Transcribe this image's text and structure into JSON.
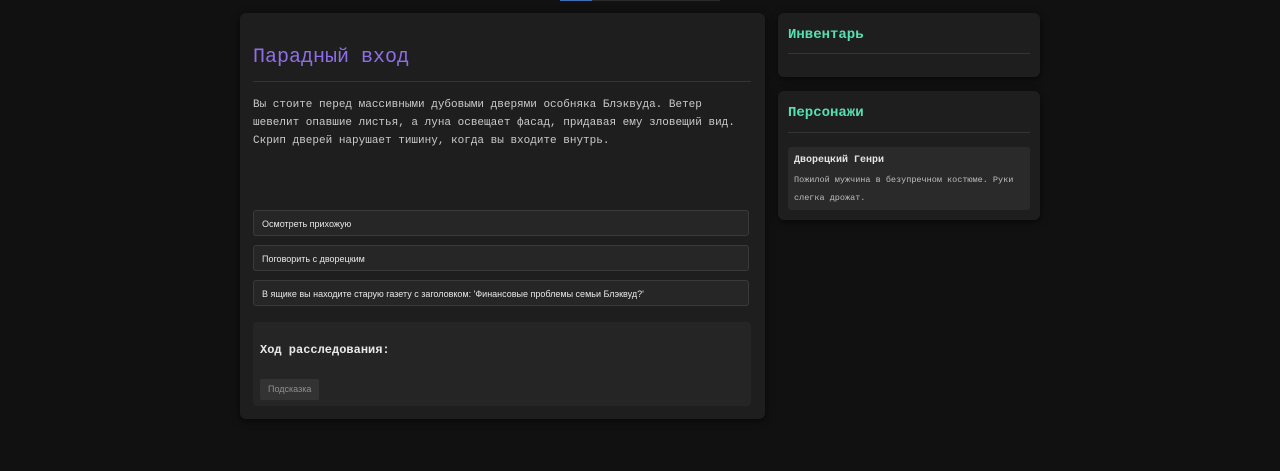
{
  "scene": {
    "title": "Парадный вход",
    "description": "Вы стоите перед массивными дубовыми дверями особняка Блэквуда. Ветер шевелит опавшие листья, а луна освещает фасад, придавая ему зловещий вид. Скрип дверей нарушает тишину, когда вы входите внутрь."
  },
  "choices": [
    {
      "label": "Осмотреть прихожую"
    },
    {
      "label": "Поговорить с дворецким"
    },
    {
      "label": "В ящике вы находите старую газету с заголовком: 'Финансовые проблемы семьи Блэквуд?'"
    }
  ],
  "investigation": {
    "title": "Ход расследования:",
    "hint_label": "Подсказка"
  },
  "inventory": {
    "title": "Инвентарь"
  },
  "characters": {
    "title": "Персонажи",
    "items": [
      {
        "name": "Дворецкий Генри",
        "description": "Пожилой мужчина в безупречном костюме. Руки слегка дрожат."
      }
    ]
  },
  "colors": {
    "background": "#111111",
    "panel": "#1e1e1e",
    "scene_title": "#8f6ee8",
    "side_title": "#55e0b0"
  }
}
